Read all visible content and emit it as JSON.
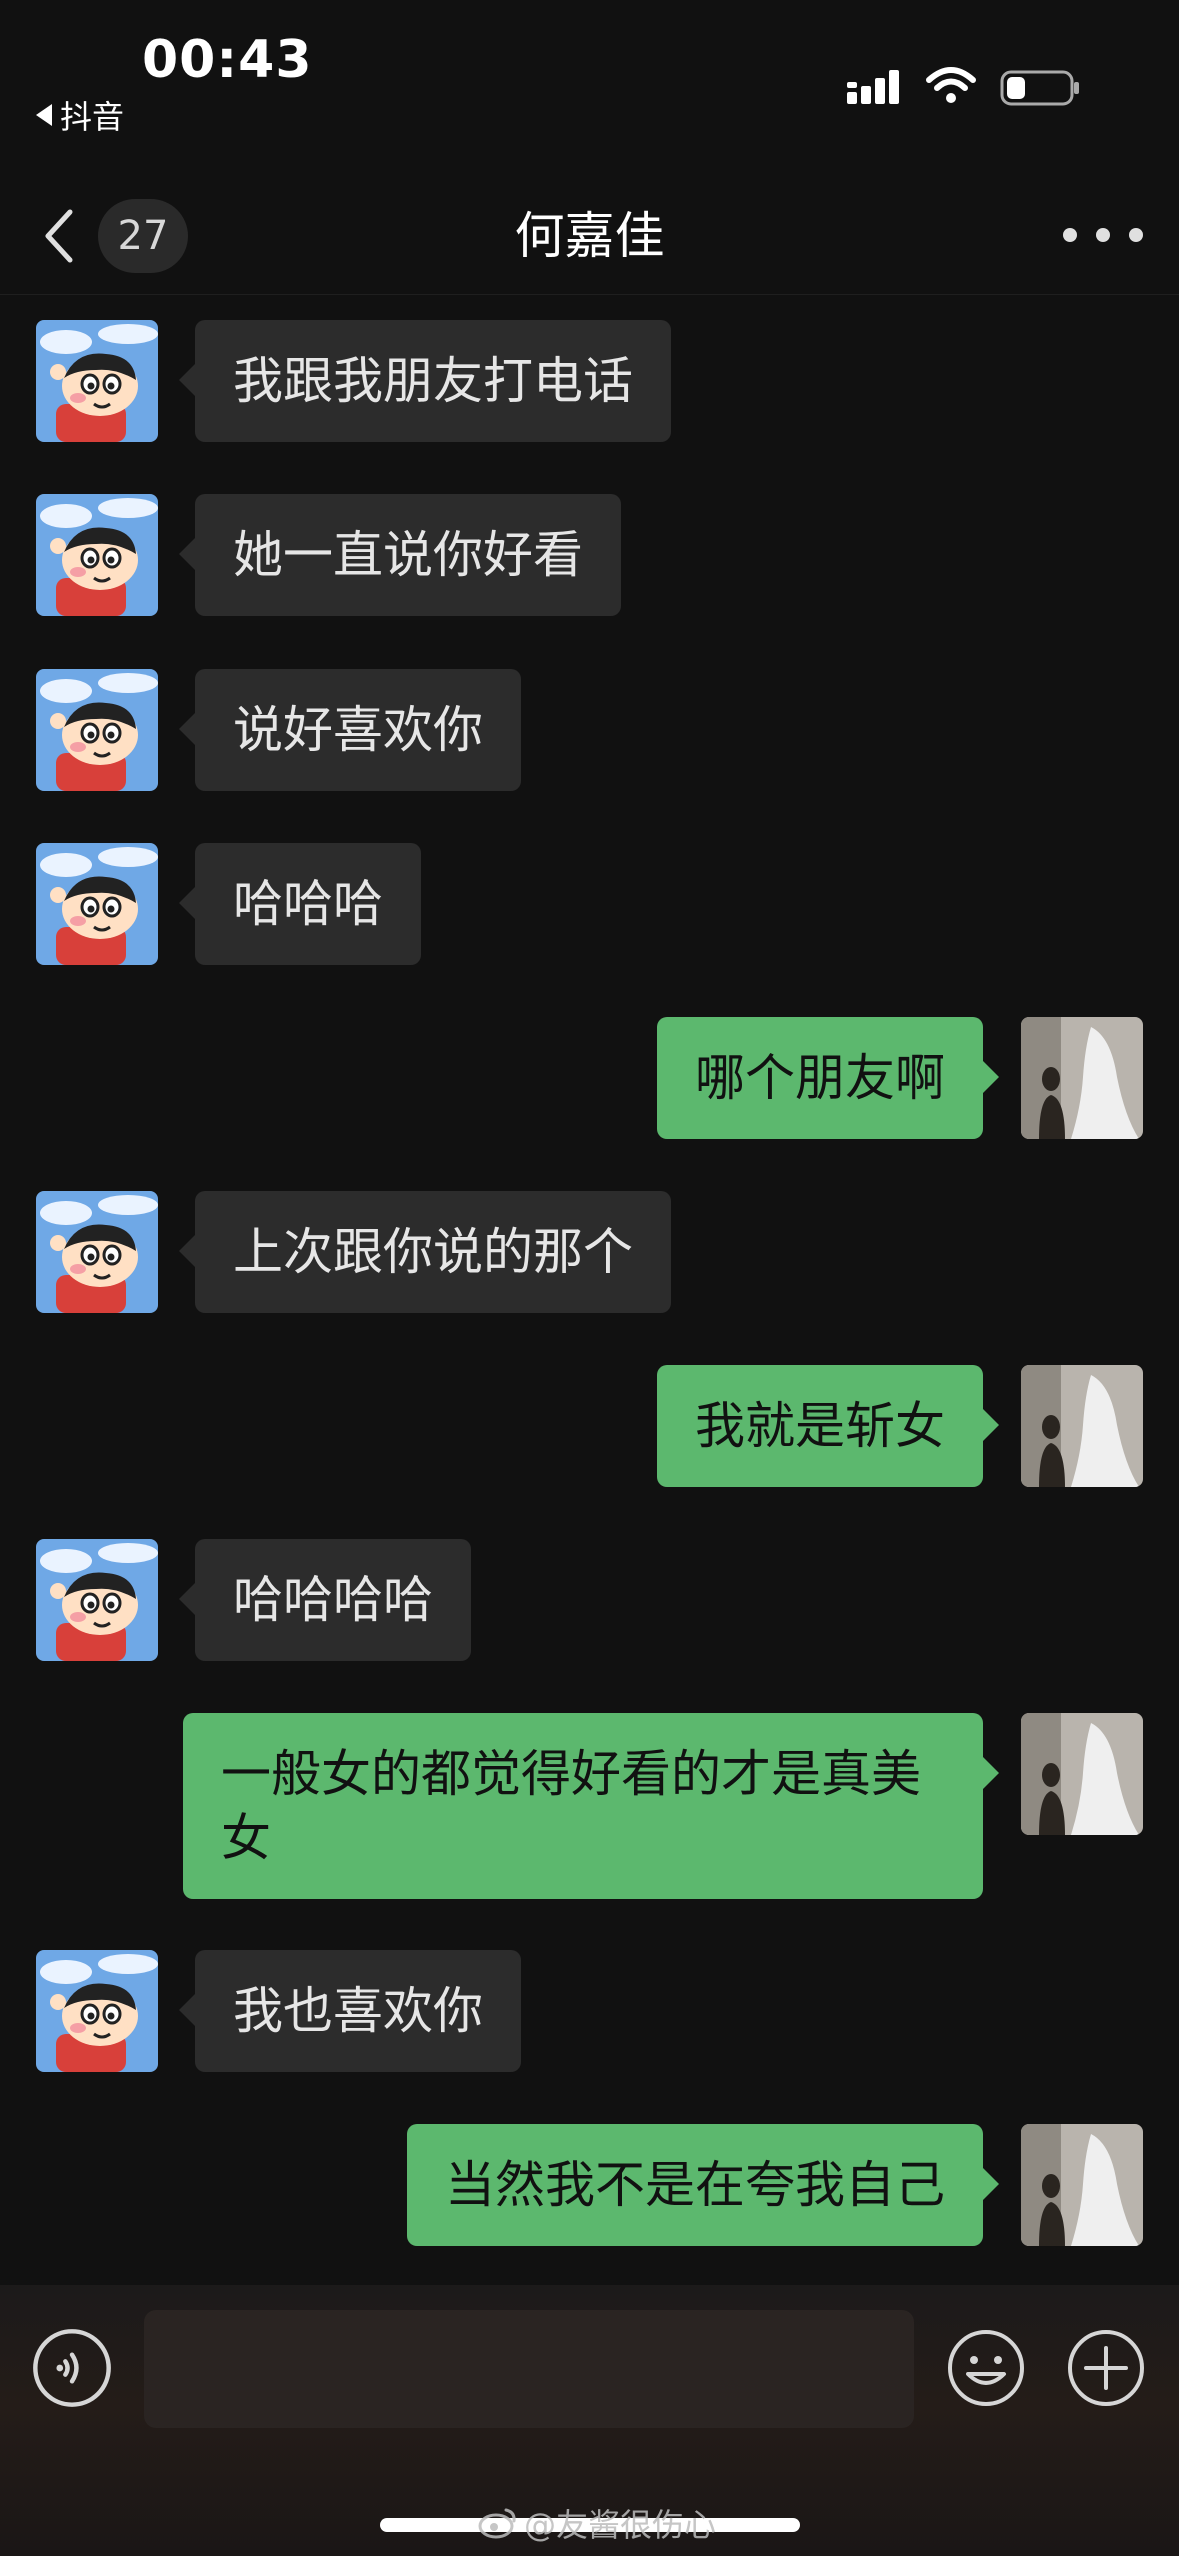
{
  "status_bar": {
    "time": "00:43",
    "back_app": "抖音"
  },
  "header": {
    "unread_count": "27",
    "title": "何嘉佳"
  },
  "messages": [
    {
      "side": "in",
      "text": "我跟我朋友打电话"
    },
    {
      "side": "in",
      "text": "她一直说你好看"
    },
    {
      "side": "in",
      "text": "说好喜欢你"
    },
    {
      "side": "in",
      "text": "哈哈哈"
    },
    {
      "side": "out",
      "text": "哪个朋友啊"
    },
    {
      "side": "in",
      "text": "上次跟你说的那个"
    },
    {
      "side": "out",
      "text": "我就是斩女"
    },
    {
      "side": "in",
      "text": "哈哈哈哈"
    },
    {
      "side": "out",
      "text": "一般女的都觉得好看的才是真美女"
    },
    {
      "side": "in",
      "text": "我也喜欢你"
    },
    {
      "side": "out",
      "text": "当然我不是在夸我自己"
    }
  ],
  "input": {
    "placeholder": ""
  },
  "watermark": "@友酱很伤心",
  "colors": {
    "background": "#111111",
    "incoming_bubble": "#2c2c2c",
    "outgoing_bubble": "#5cb86e"
  },
  "icons": [
    "chevron-left-icon",
    "more-icon",
    "signal-icon",
    "wifi-icon",
    "battery-icon",
    "voice-icon",
    "emoji-icon",
    "plus-icon",
    "weibo-icon"
  ]
}
